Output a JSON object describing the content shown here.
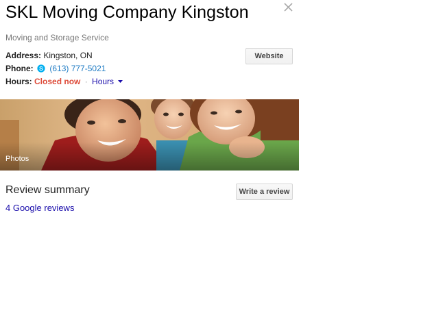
{
  "business": {
    "name": "SKL Moving Company Kingston",
    "category": "Moving and Storage Service"
  },
  "icons": {
    "close": "close-icon",
    "phone": "skype-phone-icon",
    "hours_caret": "caret-down-icon"
  },
  "address": {
    "label": "Address:",
    "value": "Kingston, ON"
  },
  "phone": {
    "label": "Phone:",
    "value": "(613) 777-5021"
  },
  "hours": {
    "label": "Hours:",
    "status": "Closed now",
    "separator": "·",
    "link": "Hours"
  },
  "buttons": {
    "website": "Website",
    "write_review": "Write a review"
  },
  "photo": {
    "label": "Photos"
  },
  "reviews": {
    "heading": "Review summary",
    "count_link": "4 Google reviews"
  },
  "colors": {
    "closed_status": "#dd4b39",
    "link": "#1a0dab",
    "phone_link": "#1e7bc4",
    "skype_blue": "#00aff0"
  }
}
